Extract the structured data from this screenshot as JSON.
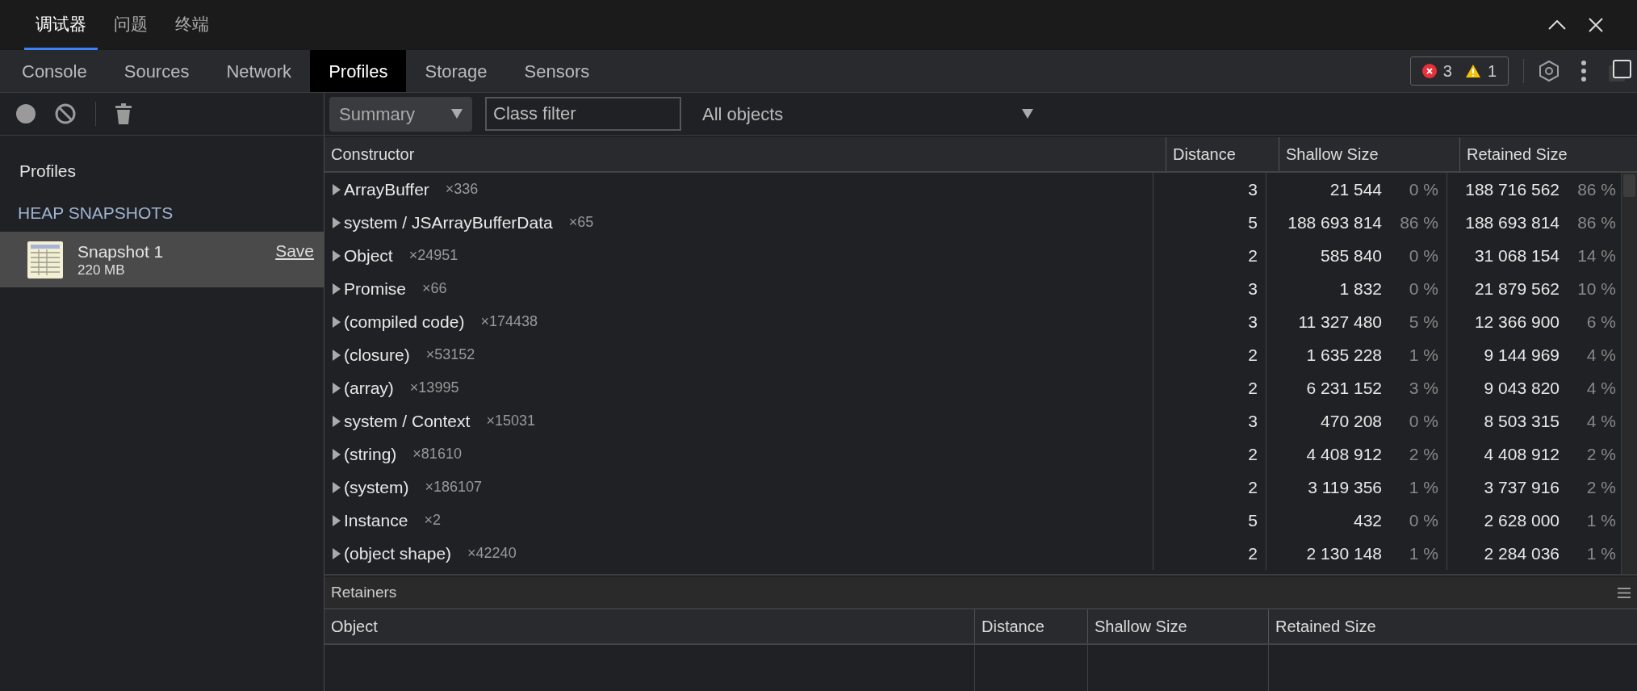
{
  "panel_tabs": [
    {
      "label": "调试器",
      "selected": true
    },
    {
      "label": "问题",
      "selected": false
    },
    {
      "label": "终端",
      "selected": false
    }
  ],
  "tool_tabs": [
    {
      "label": "Console",
      "selected": false
    },
    {
      "label": "Sources",
      "selected": false
    },
    {
      "label": "Network",
      "selected": false
    },
    {
      "label": "Profiles",
      "selected": true
    },
    {
      "label": "Storage",
      "selected": false
    },
    {
      "label": "Sensors",
      "selected": false
    }
  ],
  "issue_counts": {
    "errors": "3",
    "warnings": "1"
  },
  "sidebar": {
    "heading": "Profiles",
    "section": "HEAP SNAPSHOTS",
    "snapshots": [
      {
        "title": "Snapshot 1",
        "size": "220 MB",
        "action": "Save",
        "selected": true
      }
    ]
  },
  "toolbar": {
    "view": "Summary",
    "class_filter": {
      "placeholder": "Class filter"
    },
    "object_filter": "All objects"
  },
  "table": {
    "columns": [
      "Constructor",
      "Distance",
      "Shallow Size",
      "Retained Size"
    ],
    "rows": [
      {
        "constructor": "ArrayBuffer",
        "count": "×336",
        "distance": "3",
        "shallow_size": "21 544",
        "shallow_percent": "0 %",
        "retained_size": "188 716 562",
        "retained_percent": "86 %",
        "expanded": false
      },
      {
        "constructor": "system / JSArrayBufferData",
        "count": "×65",
        "distance": "5",
        "shallow_size": "188 693 814",
        "shallow_percent": "86 %",
        "retained_size": "188 693 814",
        "retained_percent": "86 %",
        "expanded": false
      },
      {
        "constructor": "Object",
        "count": "×24951",
        "distance": "2",
        "shallow_size": "585 840",
        "shallow_percent": "0 %",
        "retained_size": "31 068 154",
        "retained_percent": "14 %",
        "expanded": false
      },
      {
        "constructor": "Promise",
        "count": "×66",
        "distance": "3",
        "shallow_size": "1 832",
        "shallow_percent": "0 %",
        "retained_size": "21 879 562",
        "retained_percent": "10 %",
        "expanded": false
      },
      {
        "constructor": "(compiled code)",
        "count": "×174438",
        "distance": "3",
        "shallow_size": "11 327 480",
        "shallow_percent": "5 %",
        "retained_size": "12 366 900",
        "retained_percent": "6 %",
        "expanded": false
      },
      {
        "constructor": "(closure)",
        "count": "×53152",
        "distance": "2",
        "shallow_size": "1 635 228",
        "shallow_percent": "1 %",
        "retained_size": "9 144 969",
        "retained_percent": "4 %",
        "expanded": false
      },
      {
        "constructor": "(array)",
        "count": "×13995",
        "distance": "2",
        "shallow_size": "6 231 152",
        "shallow_percent": "3 %",
        "retained_size": "9 043 820",
        "retained_percent": "4 %",
        "expanded": false
      },
      {
        "constructor": "system / Context",
        "count": "×15031",
        "distance": "3",
        "shallow_size": "470 208",
        "shallow_percent": "0 %",
        "retained_size": "8 503 315",
        "retained_percent": "4 %",
        "expanded": false
      },
      {
        "constructor": "(string)",
        "count": "×81610",
        "distance": "2",
        "shallow_size": "4 408 912",
        "shallow_percent": "2 %",
        "retained_size": "4 408 912",
        "retained_percent": "2 %",
        "expanded": false
      },
      {
        "constructor": "(system)",
        "count": "×186107",
        "distance": "2",
        "shallow_size": "3 119 356",
        "shallow_percent": "1 %",
        "retained_size": "3 737 916",
        "retained_percent": "2 %",
        "expanded": false
      },
      {
        "constructor": "Instance",
        "count": "×2",
        "distance": "5",
        "shallow_size": "432",
        "shallow_percent": "0 %",
        "retained_size": "2 628 000",
        "retained_percent": "1 %",
        "expanded": false
      },
      {
        "constructor": "(object shape)",
        "count": "×42240",
        "distance": "2",
        "shallow_size": "2 130 148",
        "shallow_percent": "1 %",
        "retained_size": "2 284 036",
        "retained_percent": "1 %",
        "expanded": false
      }
    ]
  },
  "retainers": {
    "title": "Retainers",
    "columns": [
      "Object",
      "Distance",
      "Shallow Size",
      "Retained Size"
    ]
  }
}
